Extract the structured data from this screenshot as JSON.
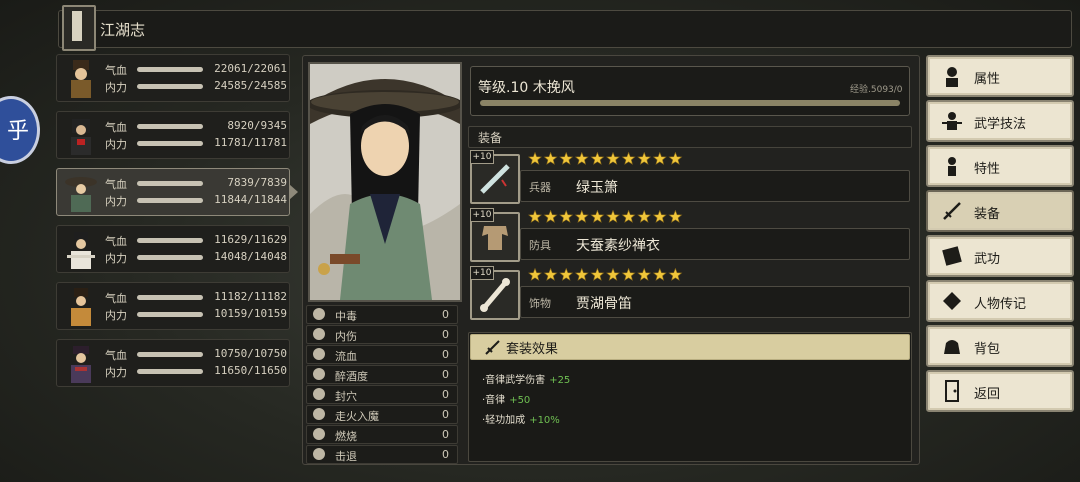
{
  "title": "江湖志",
  "side_button": "乎",
  "stat_labels": {
    "hp": "气血",
    "mp": "内力"
  },
  "characters": [
    {
      "hp": "22061/22061",
      "mp": "24585/24585"
    },
    {
      "hp": "8920/9345",
      "mp": "11781/11781"
    },
    {
      "hp": "7839/7839",
      "mp": "11844/11844"
    },
    {
      "hp": "11629/11629",
      "mp": "14048/14048"
    },
    {
      "hp": "11182/11182",
      "mp": "10159/10159"
    },
    {
      "hp": "10750/10750",
      "mp": "11650/11650"
    }
  ],
  "selected_character_index": 2,
  "level": "等级.10 木挽风",
  "exp": "经验.5093/0",
  "equip_header": "装备",
  "equipment": [
    {
      "plus": "+10",
      "type": "兵器",
      "name": "绿玉箫",
      "stars": 10
    },
    {
      "plus": "+10",
      "type": "防具",
      "name": "天蚕素纱禅衣",
      "stars": 10
    },
    {
      "plus": "+10",
      "type": "饰物",
      "name": "贾湖骨笛",
      "stars": 10
    }
  ],
  "statuses": [
    {
      "label": "中毒",
      "value": "0"
    },
    {
      "label": "内伤",
      "value": "0"
    },
    {
      "label": "流血",
      "value": "0"
    },
    {
      "label": "醉酒度",
      "value": "0"
    },
    {
      "label": "封穴",
      "value": "0"
    },
    {
      "label": "走火入魔",
      "value": "0"
    },
    {
      "label": "燃烧",
      "value": "0"
    },
    {
      "label": "击退",
      "value": "0"
    }
  ],
  "set_effect": {
    "title": "套装效果",
    "lines": [
      {
        "label": "·音律武学伤害",
        "bonus": "+25"
      },
      {
        "label": "·音律",
        "bonus": "+50"
      },
      {
        "label": "·轻功加成",
        "bonus": "+10%"
      }
    ]
  },
  "menu": [
    {
      "label": "属性",
      "icon": "person-icon"
    },
    {
      "label": "武学技法",
      "icon": "martial-skill-icon"
    },
    {
      "label": "特性",
      "icon": "trait-icon"
    },
    {
      "label": "装备",
      "icon": "sword-icon",
      "active": true
    },
    {
      "label": "武功",
      "icon": "manual-icon"
    },
    {
      "label": "人物传记",
      "icon": "biography-icon"
    },
    {
      "label": "背包",
      "icon": "bag-icon"
    },
    {
      "label": "返回",
      "icon": "door-icon"
    }
  ],
  "colors": {
    "accent": "#d8cda0",
    "bonus": "#6fbf52",
    "star": "#f0c63a"
  }
}
